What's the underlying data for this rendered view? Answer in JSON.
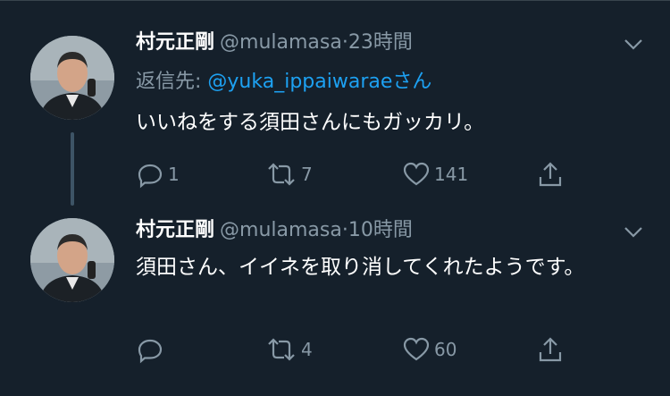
{
  "tweets": [
    {
      "name": "村元正剛",
      "handle": "@mulamasa",
      "separator": "·",
      "time": "23時間",
      "reply_prefix": "返信先: ",
      "reply_handle": "@yuka_ippaiwarae",
      "reply_suffix": "さん",
      "text": "いいねをする須田さんにもガッカリ。",
      "reply_count": "1",
      "retweet_count": "7",
      "like_count": "141"
    },
    {
      "name": "村元正剛",
      "handle": "@mulamasa",
      "separator": "·",
      "time": "10時間",
      "text": "須田さん、イイネを取り消してくれたようです。",
      "reply_count": "",
      "retweet_count": "4",
      "like_count": "60"
    }
  ],
  "colors": {
    "background": "#15202b",
    "secondary_text": "#8899a6",
    "link": "#1da1f2",
    "divider": "#38444d"
  },
  "icons": [
    "caret-down-icon",
    "reply-icon",
    "retweet-icon",
    "like-icon",
    "share-icon"
  ]
}
